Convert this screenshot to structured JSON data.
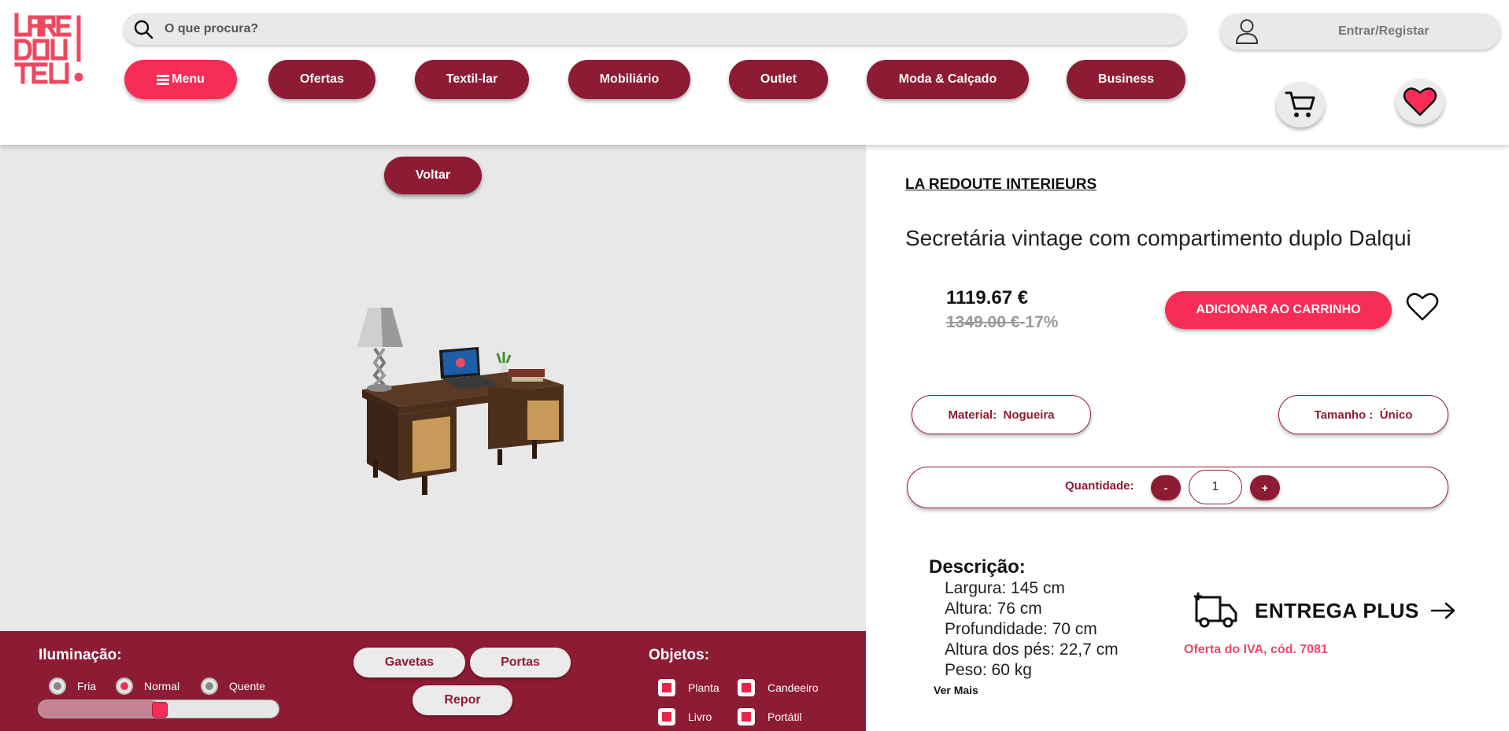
{
  "header": {
    "logo_text": [
      "LARE",
      "DOU",
      "TE"
    ],
    "search": {
      "placeholder": "O que procura?"
    },
    "login_label": "Entrar/Registar",
    "nav": {
      "menu": "Menu",
      "ofertas": "Ofertas",
      "textil": "Textil-lar",
      "mobiliario": "Mobiliário",
      "outlet": "Outlet",
      "moda": "Moda & Calçado",
      "business": "Business"
    }
  },
  "viewer": {
    "back_label": "Voltar"
  },
  "controls": {
    "lighting_title": "Iluminação:",
    "lighting_options": [
      "Fria",
      "Normal",
      "Quente"
    ],
    "lighting_selected": "Normal",
    "lighting_level": 0.5,
    "buttons": {
      "gavetas": "Gavetas",
      "portas": "Portas",
      "repor": "Repor"
    },
    "objects_title": "Objetos:",
    "objects": [
      "Planta",
      "Candeeiro",
      "Livro",
      "Portátil"
    ]
  },
  "product": {
    "brand": "LA REDOUTE INTERIEURS",
    "title": "Secretária vintage com compartimento duplo Dalqui",
    "price": "1119.67 €",
    "old_price": "1349.00 €",
    "discount": "-17%",
    "add_to_cart": "ADICIONAR AO CARRINHO",
    "material_label": "Material:",
    "material_value": "Nogueira",
    "size_label": "Tamanho :",
    "size_value": "Único",
    "quantity_label": "Quantidade:",
    "quantity_minus": "-",
    "quantity_plus": "+",
    "quantity_value": "1",
    "description_title": "Descrição:",
    "description_lines": [
      "Largura: 145 cm",
      "Altura: 76 cm",
      "Profundidade: 70 cm",
      "Altura dos pés: 22,7 cm",
      "Peso: 60 kg"
    ],
    "more_label": "Ver Mais",
    "delivery_title": "ENTREGA PLUS",
    "delivery_offer": "Oferta do IVA, cód. 7081"
  },
  "colors": {
    "brand_red": "#8e1b34",
    "accent_pink": "#f72c57",
    "light_gray": "#e8e8e8"
  }
}
